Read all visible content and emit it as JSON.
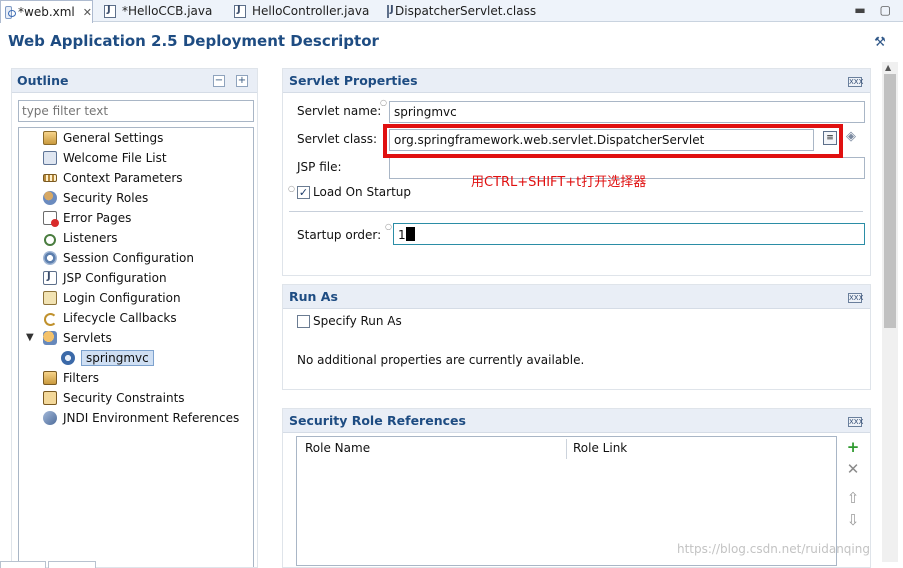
{
  "tabs": [
    {
      "label": "*web.xml",
      "icon": "xml-file-icon",
      "active": true
    },
    {
      "label": "*HelloCCB.java",
      "icon": "java-file-icon"
    },
    {
      "label": "HelloController.java",
      "icon": "java-file-icon"
    },
    {
      "label": "DispatcherServlet.class",
      "icon": "class-file-icon"
    }
  ],
  "window_controls": {
    "minimize": "▬",
    "maximize": "▢"
  },
  "header": {
    "title": "Web Application 2.5 Deployment Descriptor"
  },
  "outline": {
    "title": "Outline",
    "filter_placeholder": "type filter text",
    "items": [
      {
        "label": "General Settings",
        "icon": "general-settings-icon"
      },
      {
        "label": "Welcome File List",
        "icon": "welcome-file-icon"
      },
      {
        "label": "Context Parameters",
        "icon": "context-parameters-icon"
      },
      {
        "label": "Security Roles",
        "icon": "security-roles-icon"
      },
      {
        "label": "Error Pages",
        "icon": "error-pages-icon"
      },
      {
        "label": "Listeners",
        "icon": "listeners-icon"
      },
      {
        "label": "Session Configuration",
        "icon": "session-configuration-icon"
      },
      {
        "label": "JSP Configuration",
        "icon": "jsp-configuration-icon"
      },
      {
        "label": "Login Configuration",
        "icon": "login-configuration-icon"
      },
      {
        "label": "Lifecycle Callbacks",
        "icon": "lifecycle-callbacks-icon"
      },
      {
        "label": "Servlets",
        "icon": "servlets-icon",
        "expanded": true
      },
      {
        "label": "springmvc",
        "icon": "servlet-mapping-icon",
        "selected": true
      },
      {
        "label": "Filters",
        "icon": "filters-icon"
      },
      {
        "label": "Security Constraints",
        "icon": "security-constraints-icon"
      },
      {
        "label": "JNDI Environment References",
        "icon": "jndi-references-icon"
      }
    ]
  },
  "servlet_properties": {
    "title": "Servlet Properties",
    "name_label": "Servlet name:",
    "name_value": "springmvc",
    "class_label": "Servlet class:",
    "class_value": "org.springframework.web.servlet.DispatcherServlet",
    "jsp_label": "JSP file:",
    "jsp_value": "",
    "load_on_startup_label": "Load On Startup",
    "load_on_startup_checked": true,
    "startup_order_label": "Startup order:",
    "startup_order_value": "1",
    "annotation_note": "用CTRL+SHIFT+t打开选择器"
  },
  "run_as": {
    "title": "Run As",
    "specify_label": "Specify Run As",
    "specify_checked": false,
    "info_text": "No additional properties are currently available."
  },
  "security_role_refs": {
    "title": "Security Role References",
    "columns": [
      "Role Name",
      "Role Link"
    ],
    "rows": []
  },
  "watermark": "https://blog.csdn.net/ruidanqing",
  "colors": {
    "section_title": "#1e4c82",
    "annotation_red": "#e01010",
    "header_bg": "#e9eef6"
  }
}
